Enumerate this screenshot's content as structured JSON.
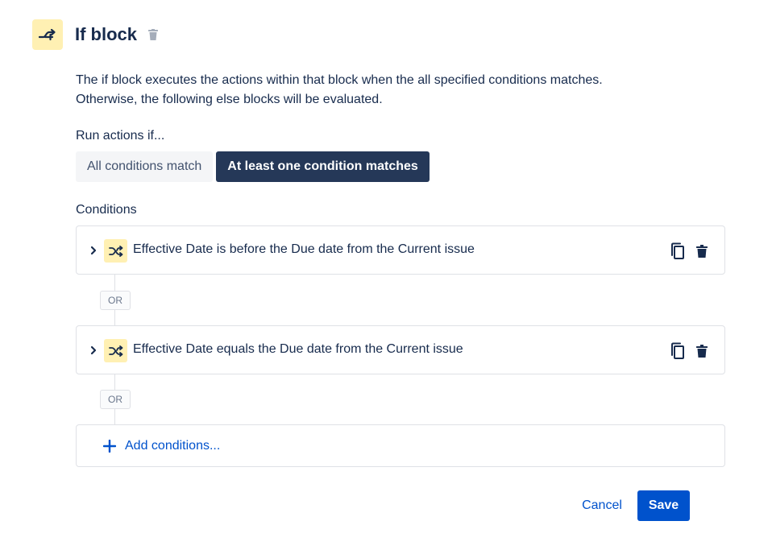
{
  "header": {
    "title": "If block",
    "icon": "branch-icon",
    "delete_icon": "trash-icon"
  },
  "description": {
    "line1": "The if block executes the actions within that block when the all specified conditions matches.",
    "line2": "Otherwise, the following else blocks will be evaluated."
  },
  "run_actions": {
    "label": "Run actions if...",
    "options": [
      {
        "label": "All conditions match",
        "selected": false
      },
      {
        "label": "At least one condition matches",
        "selected": true
      }
    ]
  },
  "conditions": {
    "label": "Conditions",
    "items": [
      {
        "text": "Effective Date is before the Due date from the Current issue",
        "icon": "shuffle-icon"
      },
      {
        "text": "Effective Date equals the Due date from the Current issue",
        "icon": "shuffle-icon"
      }
    ],
    "separator": "OR",
    "add_label": "Add conditions..."
  },
  "footer": {
    "cancel_label": "Cancel",
    "save_label": "Save"
  },
  "colors": {
    "accent": "#0052cc",
    "selected_segment": "#253858",
    "icon_bg": "#fff0b3",
    "text": "#172b4d"
  }
}
